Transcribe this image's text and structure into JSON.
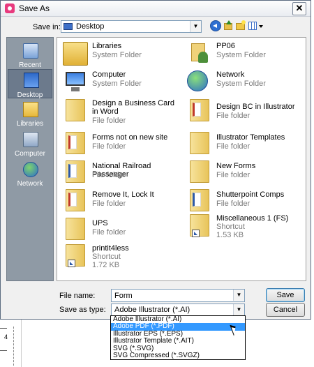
{
  "window": {
    "title": "Save As"
  },
  "save_in": {
    "label": "Save in:",
    "value": "Desktop"
  },
  "places": [
    {
      "label": "Recent Places"
    },
    {
      "label": "Desktop"
    },
    {
      "label": "Libraries"
    },
    {
      "label": "Computer"
    },
    {
      "label": "Network"
    }
  ],
  "files": [
    {
      "name": "Libraries",
      "sub1": "System Folder",
      "sub2": "",
      "icon": "library-icon"
    },
    {
      "name": "PP06",
      "sub1": "System Folder",
      "sub2": "",
      "icon": "user-folder-icon"
    },
    {
      "name": "Computer",
      "sub1": "System Folder",
      "sub2": "",
      "icon": "computer-icon"
    },
    {
      "name": "Network",
      "sub1": "System Folder",
      "sub2": "",
      "icon": "network-icon"
    },
    {
      "name": "Design a Business Card in Word",
      "sub1": "File folder",
      "sub2": "",
      "icon": "folder-icon"
    },
    {
      "name": "Design BC in Illustrator",
      "sub1": "File folder",
      "sub2": "",
      "icon": "folder-icon"
    },
    {
      "name": "Forms not on new site",
      "sub1": "File folder",
      "sub2": "",
      "icon": "folder-icon"
    },
    {
      "name": "Illustrator Templates",
      "sub1": "File folder",
      "sub2": "",
      "icon": "folder-icon"
    },
    {
      "name": "National Railroad Passenger",
      "sub1": "File folder",
      "sub2": "",
      "icon": "folder-icon"
    },
    {
      "name": "New Forms",
      "sub1": "File folder",
      "sub2": "",
      "icon": "folder-icon"
    },
    {
      "name": "Remove It, Lock It",
      "sub1": "File folder",
      "sub2": "",
      "icon": "folder-icon"
    },
    {
      "name": "Shutterpoint Comps",
      "sub1": "File folder",
      "sub2": "",
      "icon": "folder-icon"
    },
    {
      "name": "UPS",
      "sub1": "File folder",
      "sub2": "",
      "icon": "folder-icon"
    },
    {
      "name": "Miscellaneous 1 (FS)",
      "sub1": "Shortcut",
      "sub2": "1.53 KB",
      "icon": "shortcut-folder-icon"
    },
    {
      "name": "printit4less",
      "sub1": "Shortcut",
      "sub2": "1.72 KB",
      "icon": "shortcut-folder-icon"
    }
  ],
  "file_name": {
    "label": "File name:",
    "value": "Form"
  },
  "save_as_type": {
    "label": "Save as type:",
    "value": "Adobe Illustrator (*.AI)"
  },
  "type_options": [
    "Adobe Illustrator (*.AI)",
    "Adobe PDF (*.PDF)",
    "Illustrator EPS (*.EPS)",
    "Illustrator Template (*.AIT)",
    "SVG (*.SVG)",
    "SVG Compressed (*.SVGZ)"
  ],
  "buttons": {
    "save": "Save",
    "cancel": "Cancel"
  },
  "ruler": {
    "number": "4"
  }
}
